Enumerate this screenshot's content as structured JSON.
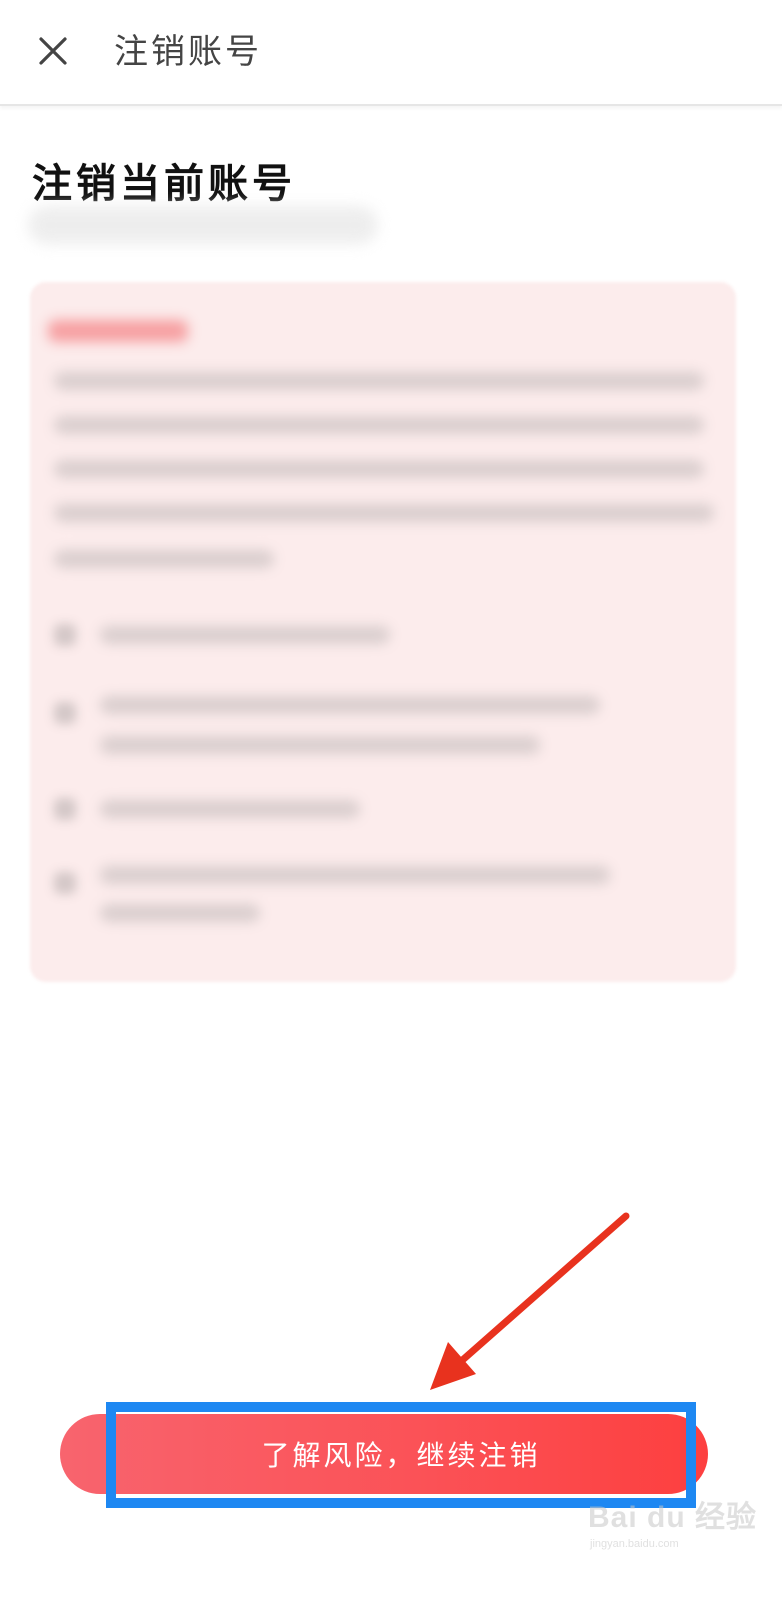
{
  "app_bar": {
    "title": "注销账号",
    "close_icon": "close-icon"
  },
  "page": {
    "heading": "注销当前账号"
  },
  "actions": {
    "confirm_label": "了解风险，继续注销"
  },
  "annotation": {
    "arrow_color": "#e8321e",
    "highlight_color": "#1e88f2"
  },
  "watermark": {
    "main": "Bai du 经验",
    "sub": "jingyan.baidu.com"
  },
  "colors": {
    "button_start": "#f8646e",
    "button_end": "#fd3f3f",
    "card_bg": "#fcecec"
  }
}
